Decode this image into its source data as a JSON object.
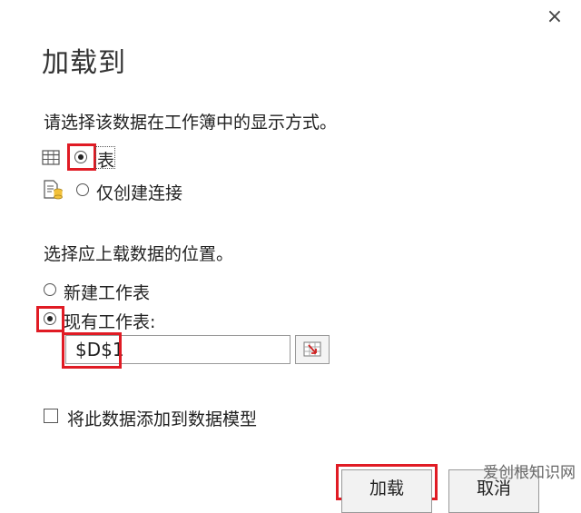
{
  "dialog": {
    "title": "加载到",
    "close_glyph": "×",
    "display_prompt": "请选择该数据在工作簿中的显示方式。",
    "display_options": [
      {
        "label": "表",
        "selected": true,
        "icon": "table-icon"
      },
      {
        "label": "仅创建连接",
        "selected": false,
        "icon": "connection-icon"
      }
    ],
    "location_prompt": "选择应上载数据的位置。",
    "location_options": [
      {
        "label": "新建工作表",
        "selected": false
      },
      {
        "label": "现有工作表:",
        "selected": true
      }
    ],
    "range_value": "$D$1",
    "range_button_icon": "range-select-icon",
    "data_model_label": "将此数据添加到数据模型",
    "data_model_checked": false,
    "load_button": "加载",
    "cancel_button": "取消",
    "watermark": "爱创根知识网"
  },
  "colors": {
    "highlight": "#e01b24",
    "text": "#222222",
    "background": "#ffffff"
  }
}
